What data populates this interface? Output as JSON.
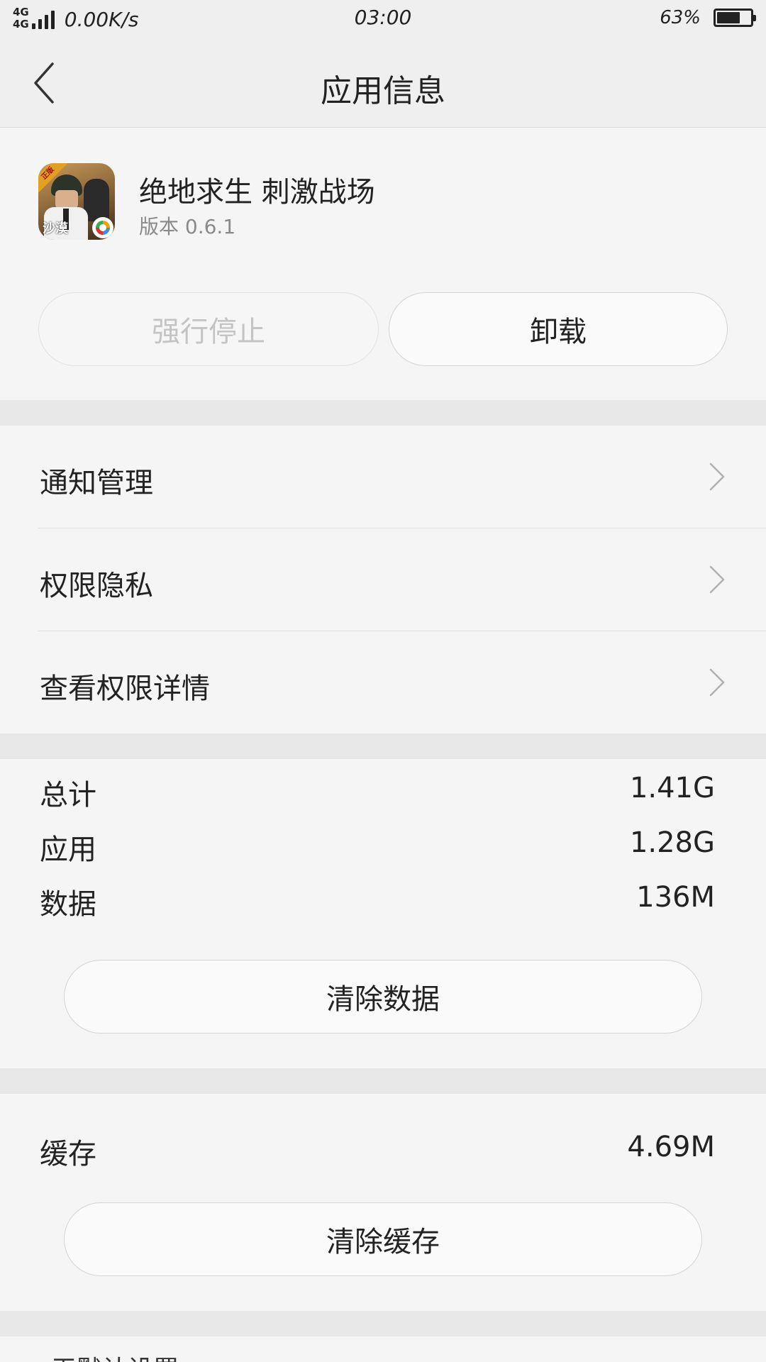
{
  "status_bar": {
    "net_type_1": "4G",
    "net_type_2": "4G",
    "net_speed": "0.00K/s",
    "time": "03:00",
    "battery_pct": "63%",
    "battery_level": 0.63,
    "signal_bars": 4
  },
  "header": {
    "title": "应用信息",
    "back_icon": "chevron-left-icon"
  },
  "app": {
    "name": "绝地求生 刺激战场",
    "version": "版本 0.6.1",
    "icon_badge": "正版",
    "icon_label": "沙漠"
  },
  "actions": {
    "force_stop": "强行停止",
    "uninstall": "卸载"
  },
  "menu": {
    "items": [
      {
        "label": "通知管理",
        "icon": "chevron-right-icon"
      },
      {
        "label": "权限隐私",
        "icon": "chevron-right-icon"
      },
      {
        "label": "查看权限详情",
        "icon": "chevron-right-icon"
      }
    ]
  },
  "storage": {
    "rows": [
      {
        "label": "总计",
        "value": "1.41G"
      },
      {
        "label": "应用",
        "value": "1.28G"
      },
      {
        "label": "数据",
        "value": "136M"
      }
    ],
    "clear_data": "清除数据"
  },
  "cache": {
    "label": "缓存",
    "value": "4.69M",
    "clear_cache": "清除缓存"
  },
  "footer": {
    "label": "无默认设置"
  },
  "colors": {
    "background": "#f5f5f5",
    "band": "#e8e8e8",
    "text": "#222222",
    "muted": "#8a8a8a",
    "disabled": "#c4c4c4"
  }
}
